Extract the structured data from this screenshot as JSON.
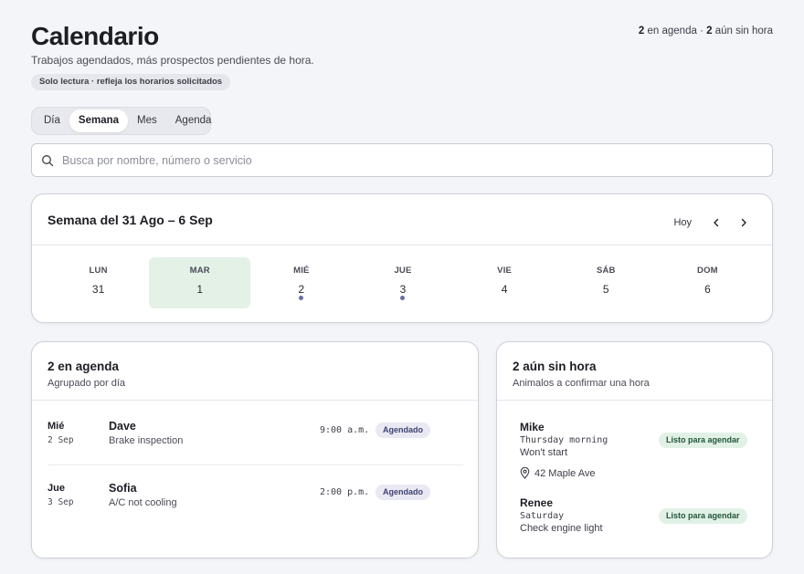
{
  "header": {
    "title": "Calendario",
    "subtitle": "Trabajos agendados, más prospectos pendientes de hora.",
    "readonly_note": "Solo lectura · refleja los horarios solicitados",
    "summary": {
      "scheduled_count": "2",
      "scheduled_text": " en agenda · ",
      "unscheduled_count": "2",
      "unscheduled_text": " aún sin hora"
    }
  },
  "view_tabs": [
    {
      "label": "Día",
      "active": false
    },
    {
      "label": "Semana",
      "active": true
    },
    {
      "label": "Mes",
      "active": false
    },
    {
      "label": "Agenda",
      "active": false
    }
  ],
  "search": {
    "placeholder": "Busca por nombre, número o servicio",
    "value": ""
  },
  "week": {
    "title": "Semana del 31 Ago – 6 Sep",
    "today_label": "Hoy",
    "days": [
      {
        "name": "LUN",
        "num": "31",
        "selected": false,
        "has_events": false
      },
      {
        "name": "MAR",
        "num": "1",
        "selected": true,
        "has_events": false
      },
      {
        "name": "MIÉ",
        "num": "2",
        "selected": false,
        "has_events": true
      },
      {
        "name": "JUE",
        "num": "3",
        "selected": false,
        "has_events": true
      },
      {
        "name": "VIE",
        "num": "4",
        "selected": false,
        "has_events": false
      },
      {
        "name": "SÁB",
        "num": "5",
        "selected": false,
        "has_events": false
      },
      {
        "name": "DOM",
        "num": "6",
        "selected": false,
        "has_events": false
      }
    ]
  },
  "agenda": {
    "title": "2 en agenda",
    "subtitle": "Agrupado por día",
    "items": [
      {
        "day": "Mié",
        "date": "2 Sep",
        "name": "Dave",
        "service": "Brake inspection",
        "time": "9:00 a.m.",
        "status": "Agendado"
      },
      {
        "day": "Jue",
        "date": "3 Sep",
        "name": "Sofia",
        "service": "A/C not cooling",
        "time": "2:00 p.m.",
        "status": "Agendado"
      }
    ]
  },
  "unscheduled": {
    "title": "2 aún sin hora",
    "subtitle": "Animalos a confirmar una hora",
    "items": [
      {
        "name": "Mike",
        "when": "Thursday morning",
        "service": "Won't start",
        "address": "42 Maple Ave",
        "status": "Listo para agendar"
      },
      {
        "name": "Renee",
        "when": "Saturday",
        "service": "Check engine light",
        "status": "Listo para agendar"
      }
    ]
  },
  "colors": {
    "selected_day_bg": "#e3f1e7",
    "event_dot": "#6b6da4",
    "booked_badge_bg": "#e9e9f4",
    "ready_badge_bg": "#e1f1e6"
  }
}
